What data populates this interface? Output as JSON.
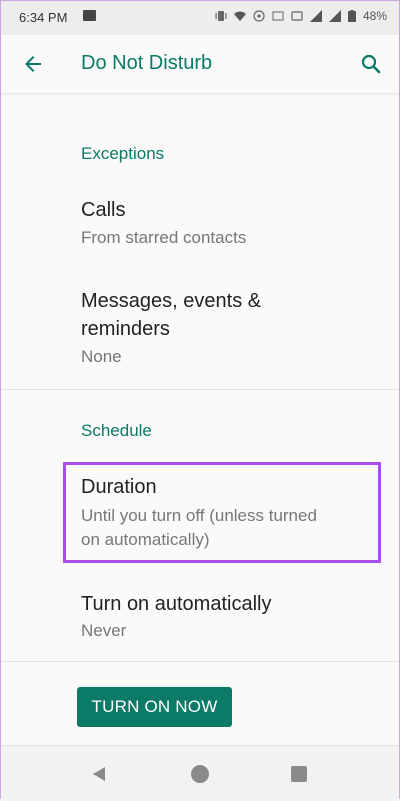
{
  "status_bar": {
    "time": "6:34 PM",
    "battery": "48%"
  },
  "app_bar": {
    "title": "Do Not Disturb"
  },
  "sections": {
    "exceptions_header": "Exceptions",
    "schedule_header": "Schedule"
  },
  "items": {
    "calls_title": "Calls",
    "calls_value": "From starred contacts",
    "messages_title_line1": "Messages, events &",
    "messages_title_line2": "reminders",
    "messages_value": "None",
    "duration_title": "Duration",
    "duration_value_line1": "Until you turn off (unless turned",
    "duration_value_line2": "on automatically)",
    "auto_title": "Turn on automatically",
    "auto_value": "Never"
  },
  "button": {
    "turn_on_label": "TURN ON NOW"
  },
  "colors": {
    "accent": "#0b7a66",
    "highlight": "#a94ee8"
  }
}
